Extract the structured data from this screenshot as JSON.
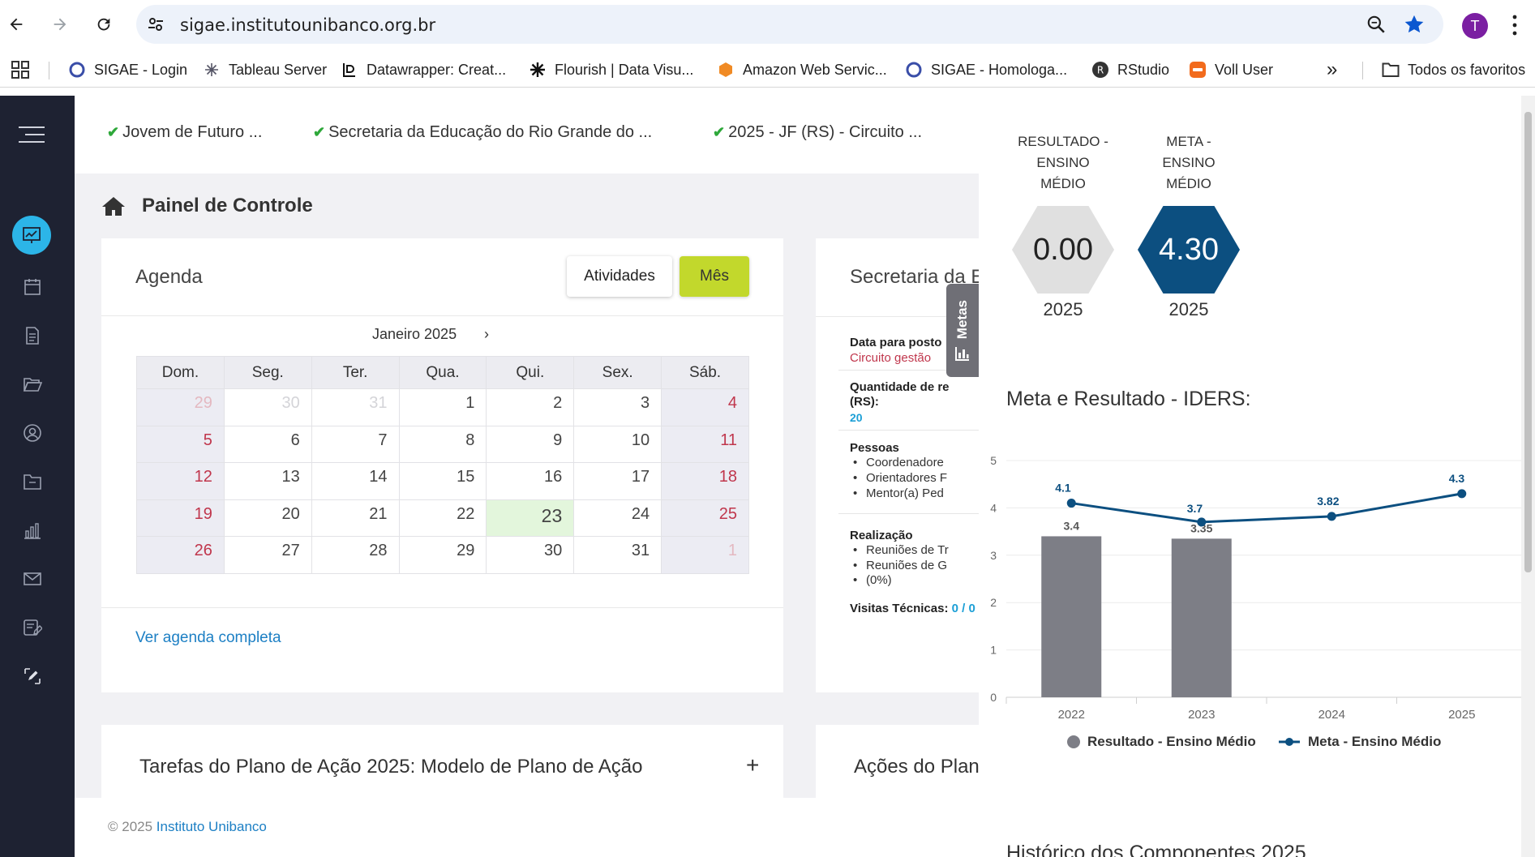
{
  "browser": {
    "url": "sigae.institutounibanco.org.br",
    "profile_initial": "T",
    "bookmarks": [
      {
        "label": "SIGAE - Login"
      },
      {
        "label": "Tableau Server"
      },
      {
        "label": "Datawrapper: Creat..."
      },
      {
        "label": "Flourish | Data Visu..."
      },
      {
        "label": "Amazon Web Servic..."
      },
      {
        "label": "SIGAE -  Homologa..."
      },
      {
        "label": "RStudio"
      },
      {
        "label": "Voll User"
      }
    ],
    "more_label": "»",
    "all_bookmarks": "Todos os favoritos"
  },
  "topnav": {
    "crumbs": [
      "Jovem de Futuro ...",
      "Secretaria da Educação do Rio Grande do ...",
      "2025 - JF (RS) - Circuito ..."
    ]
  },
  "page": {
    "title": "Painel de Controle"
  },
  "agenda": {
    "title": "Agenda",
    "btn_atividades": "Atividades",
    "btn_mes": "Mês",
    "month": "Janeiro 2025",
    "next": "›",
    "weekdays": [
      "Dom.",
      "Seg.",
      "Ter.",
      "Qua.",
      "Qui.",
      "Sex.",
      "Sáb."
    ],
    "weeks": [
      [
        "29",
        "30",
        "31",
        "1",
        "2",
        "3",
        "4"
      ],
      [
        "5",
        "6",
        "7",
        "8",
        "9",
        "10",
        "11"
      ],
      [
        "12",
        "13",
        "14",
        "15",
        "16",
        "17",
        "18"
      ],
      [
        "19",
        "20",
        "21",
        "22",
        "23",
        "24",
        "25"
      ],
      [
        "26",
        "27",
        "28",
        "29",
        "30",
        "31",
        "1"
      ]
    ],
    "link": "Ver agenda completa"
  },
  "secretaria": {
    "title": "Secretaria da E",
    "data_label": "Data para posto",
    "data_value": "Circuito gestão",
    "quantidade_label_1": "Quantidade de re",
    "quantidade_label_2": "(RS):",
    "quantidade_value": "20",
    "pessoas_label": "Pessoas",
    "pessoas_items": [
      "Coordenadore",
      "Orientadores F",
      "Mentor(a) Ped"
    ],
    "realizacao_label": "Realização",
    "realizacao_items": [
      "Reuniões de Tr",
      "Reuniões de G"
    ],
    "realizacao_extra": "(0%)",
    "visitas_label": "Visitas Técnicas:",
    "visitas_value": "0 / 0"
  },
  "tarefas": {
    "title": "Tarefas do Plano de Ação 2025: Modelo de Plano de Ação",
    "plus": "+"
  },
  "acoes": {
    "title": "Ações do Plan"
  },
  "footer": {
    "copy": "© 2025 ",
    "org": "Instituto Unibanco"
  },
  "metas_tab": {
    "label": "Metas"
  },
  "panel": {
    "result_label": [
      "RESULTADO -",
      "ENSINO",
      "MÉDIO"
    ],
    "meta_label": [
      "META -",
      "ENSINO",
      "MÉDIO"
    ],
    "result_value": "0.00",
    "meta_value": "4.30",
    "result_year": "2025",
    "meta_year": "2025",
    "chart_heading": "Meta e Resultado - IDERS:",
    "next_heading": "Histórico dos Componentes 2025"
  },
  "colors": {
    "bar": "#7d7e86",
    "line": "#0c4f80",
    "accent_green": "#c2d82c",
    "sidebar": "#1e2232"
  },
  "chart_data": {
    "type": "bar",
    "title": "Meta e Resultado - IDERS:",
    "categories": [
      "2022",
      "2023",
      "2024",
      "2025"
    ],
    "ylim": [
      0,
      5
    ],
    "yticks": [
      "0",
      "1",
      "2",
      "3",
      "4",
      "5"
    ],
    "grid": true,
    "legend": "bottom",
    "series": [
      {
        "name": "Resultado - Ensino Médio",
        "kind": "bar",
        "values": [
          3.4,
          3.35,
          null,
          null
        ],
        "labels": [
          "3.4",
          "3.35",
          "",
          ""
        ]
      },
      {
        "name": "Meta - Ensino Médio",
        "kind": "line",
        "values": [
          4.1,
          3.7,
          3.82,
          4.3
        ],
        "labels": [
          "4.1",
          "3.7",
          "3.82",
          "4.3"
        ]
      }
    ]
  }
}
